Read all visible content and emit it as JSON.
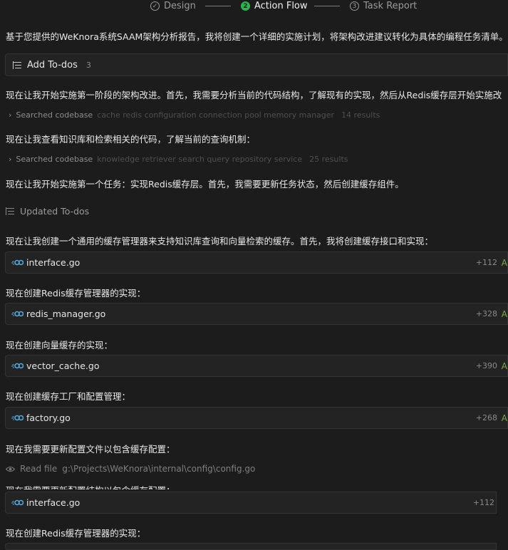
{
  "stepper": {
    "steps": [
      {
        "label": "Design",
        "marker": "✓"
      },
      {
        "label": "Action Flow",
        "marker": "2"
      },
      {
        "label": "Task Report",
        "marker": "3"
      }
    ],
    "active_index": 1,
    "accent": "#2cb24e"
  },
  "messages": {
    "intro": "基于您提供的WeKnora系统SAAM架构分析报告，我将创建一个详细的实施计划，将架构改进建议转化为具体的编程任务清单。",
    "phase1": "现在让我开始实施第一阶段的架构改进。首先，我需要分析当前的代码结构，了解现有的实现，然后从Redis缓存层开始实施改",
    "view_kb": "现在让我查看知识库和检索相关的代码，了解当前的查询机制：",
    "task1": "现在让我开始实施第一个任务：实现Redis缓存层。首先，我需要更新任务状态，然后创建缓存组件。",
    "cache_mgr": "现在让我创建一个通用的缓存管理器来支持知识库查询和向量检索的缓存。首先，我将创建缓存接口和实现：",
    "redis_impl": "现在创建Redis缓存管理器的实现：",
    "vector_impl": "现在创建向量缓存的实现：",
    "factory_impl": "现在创建缓存工厂和配置管理：",
    "config_update": "现在我需要更新配置文件以包含缓存配置：",
    "config_struct": "现在我需要更新配置结构以包含缓存配置：",
    "redis_impl_2": "现在创建Redis缓存管理器的实现："
  },
  "todo": {
    "title": "Add To-dos",
    "count": "3"
  },
  "updated_todos": "Updated To-dos",
  "searches": [
    {
      "label": "Searched codebase",
      "query": "cache redis configuration connection pool memory manager",
      "results": "14 results"
    },
    {
      "label": "Searched codebase",
      "query": "knowledge retriever search query repository service",
      "results": "25 results"
    }
  ],
  "files": [
    {
      "name": "interface.go",
      "added": "+112",
      "letter": "A"
    },
    {
      "name": "redis_manager.go",
      "added": "+328",
      "letter": "A"
    },
    {
      "name": "vector_cache.go",
      "added": "+390",
      "letter": "A"
    },
    {
      "name": "factory.go",
      "added": "+268",
      "letter": "A"
    },
    {
      "name": "interface.go",
      "added": "+112",
      "letter": ""
    }
  ],
  "read_file": {
    "label": "Read file",
    "path": "g:\\Projects\\WeKnora\\internal\\config\\config.go"
  },
  "colors": {
    "background": "#1c1c1c",
    "panel": "#232323",
    "added_letter": "#7fae3d",
    "go_icon": "#4fa9d8"
  }
}
